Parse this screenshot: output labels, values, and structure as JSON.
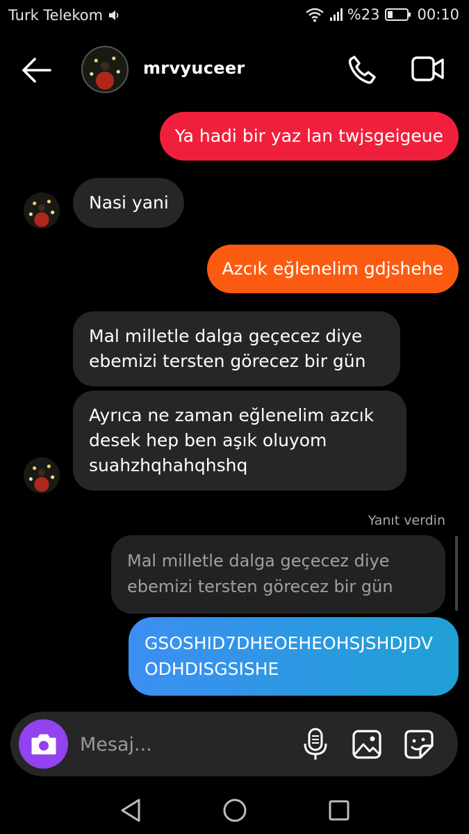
{
  "status_bar": {
    "carrier": "Turk Telekom",
    "battery": "%23",
    "time": "00:10"
  },
  "header": {
    "username": "mrvyuceer",
    "icons": [
      "back-arrow-icon",
      "avatar",
      "phone-icon",
      "video-camera-icon"
    ]
  },
  "messages": [
    {
      "sender": "me",
      "text": "Ya hadi bir yaz lan twjsgeigeue",
      "color": "#f0203c"
    },
    {
      "sender": "them",
      "text": "Nasi yani"
    },
    {
      "sender": "me",
      "text": "Azcık eğlenelim gdjshehe",
      "color": "#fb5b11"
    },
    {
      "sender": "them",
      "text": "Mal milletle dalga geçecez diye ebemizi tersten görecez bir gün"
    },
    {
      "sender": "them",
      "text": "Ayrıca ne zaman eğlenelim azcık desek hep ben aşık oluyom suahzhqhahqhshq"
    },
    {
      "sender": "me",
      "text": "GSOSHID7DHEOEHEOHSJSHDJDVODHDISGSISHE",
      "color": "#3c8ff3"
    }
  ],
  "reply": {
    "label": "Yanıt verdin",
    "quoted": "Mal milletle dalga geçecez diye ebemizi tersten görecez bir gün"
  },
  "composer": {
    "placeholder": "Mesaj...",
    "icons": [
      "camera-icon",
      "microphone-icon",
      "gallery-icon",
      "sticker-icon"
    ]
  },
  "nav_bar": {
    "icons": [
      "back-triangle-icon",
      "home-circle-icon",
      "recents-square-icon"
    ]
  }
}
